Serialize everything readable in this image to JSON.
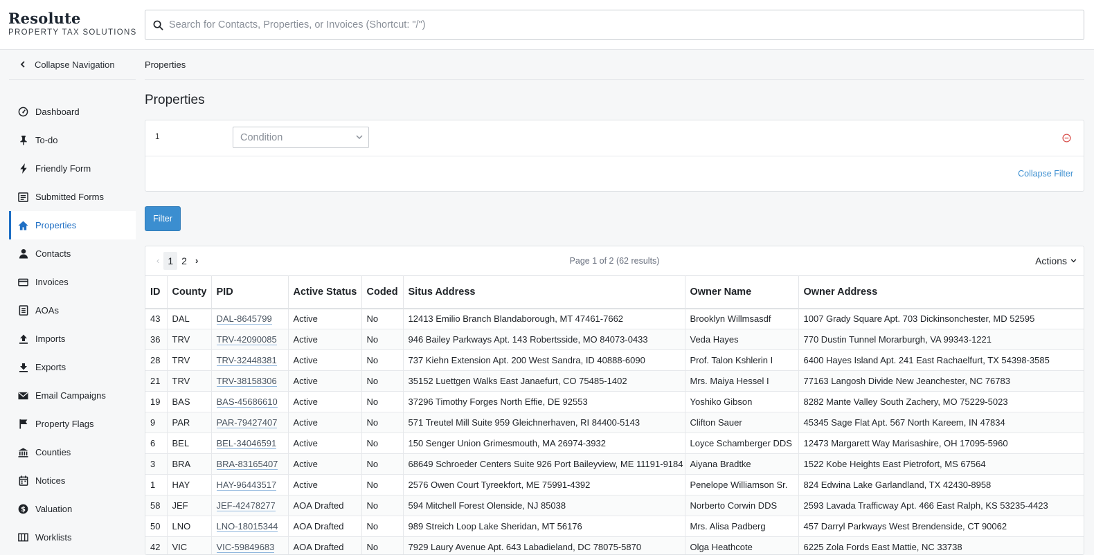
{
  "brand": {
    "name": "Resolute",
    "subtitle": "PROPERTY TAX SOLUTIONS"
  },
  "search": {
    "placeholder": "Search for Contacts, Properties, or Invoices (Shortcut: \"/\")"
  },
  "sidebar": {
    "collapse_label": "Collapse Navigation",
    "items": [
      {
        "label": "Dashboard",
        "icon": "dashboard-icon"
      },
      {
        "label": "To-do",
        "icon": "pin-icon"
      },
      {
        "label": "Friendly Form",
        "icon": "lightning-icon"
      },
      {
        "label": "Submitted Forms",
        "icon": "form-icon"
      },
      {
        "label": "Properties",
        "icon": "home-icon",
        "active": true
      },
      {
        "label": "Contacts",
        "icon": "person-icon"
      },
      {
        "label": "Invoices",
        "icon": "card-icon"
      },
      {
        "label": "AOAs",
        "icon": "document-icon"
      },
      {
        "label": "Imports",
        "icon": "upload-icon"
      },
      {
        "label": "Exports",
        "icon": "download-icon"
      },
      {
        "label": "Email Campaigns",
        "icon": "envelope-icon"
      },
      {
        "label": "Property Flags",
        "icon": "flag-icon"
      },
      {
        "label": "Counties",
        "icon": "bank-icon"
      },
      {
        "label": "Notices",
        "icon": "calendar-icon"
      },
      {
        "label": "Valuation",
        "icon": "dollar-circle-icon"
      },
      {
        "label": "Worklists",
        "icon": "columns-icon"
      }
    ]
  },
  "breadcrumb": "Properties",
  "page_title": "Properties",
  "filter": {
    "index": "1",
    "condition_placeholder": "Condition",
    "collapse_label": "Collapse Filter",
    "button_label": "Filter"
  },
  "pager": {
    "prev": "‹",
    "pages": [
      "1",
      "2"
    ],
    "current": "1",
    "next": "›",
    "info": "Page 1 of 2 (62 results)"
  },
  "actions_label": "Actions",
  "colors": {
    "accent": "#3b8ed0",
    "active_nav": "#1f6fc4",
    "danger": "#d9534f"
  },
  "table": {
    "columns": [
      "ID",
      "County",
      "PID",
      "Active Status",
      "Coded",
      "Situs Address",
      "Owner Name",
      "Owner Address"
    ],
    "rows": [
      [
        "43",
        "DAL",
        "DAL-8645799",
        "Active",
        "No",
        "12413 Emilio Branch Blandaborough, MT 47461-7662",
        "Brooklyn Willmsasdf",
        "1007 Grady Square Apt. 703 Dickinsonchester, MD 52595"
      ],
      [
        "36",
        "TRV",
        "TRV-42090085",
        "Active",
        "No",
        "946 Bailey Parkways Apt. 143 Robertsside, MO 84073-0433",
        "Veda Hayes",
        "770 Dustin Tunnel Morarburgh, VA 99343-1221"
      ],
      [
        "28",
        "TRV",
        "TRV-32448381",
        "Active",
        "No",
        "737 Kiehn Extension Apt. 200 West Sandra, ID 40888-6090",
        "Prof. Talon Kshlerin I",
        "6400 Hayes Island Apt. 241 East Rachaelfurt, TX 54398-3585"
      ],
      [
        "21",
        "TRV",
        "TRV-38158306",
        "Active",
        "No",
        "35152 Luettgen Walks East Janaefurt, CO 75485-1402",
        "Mrs. Maiya Hessel I",
        "77163 Langosh Divide New Jeanchester, NC 76783"
      ],
      [
        "19",
        "BAS",
        "BAS-45686610",
        "Active",
        "No",
        "37296 Timothy Forges North Effie, DE 92553",
        "Yoshiko Gibson",
        "8282 Mante Valley South Zachery, MO 75229-5023"
      ],
      [
        "9",
        "PAR",
        "PAR-79427407",
        "Active",
        "No",
        "571 Treutel Mill Suite 959 Gleichnerhaven, RI 84400-5143",
        "Clifton Sauer",
        "45345 Sage Flat Apt. 567 North Kareem, IN 47834"
      ],
      [
        "6",
        "BEL",
        "BEL-34046591",
        "Active",
        "No",
        "150 Senger Union Grimesmouth, MA 26974-3932",
        "Loyce Schamberger DDS",
        "12473 Margarett Way Marisashire, OH 17095-5960"
      ],
      [
        "3",
        "BRA",
        "BRA-83165407",
        "Active",
        "No",
        "68649 Schroeder Centers Suite 926 Port Baileyview, ME 11191-9184",
        "Aiyana Bradtke",
        "1522 Kobe Heights East Pietrofort, MS 67564"
      ],
      [
        "1",
        "HAY",
        "HAY-96443517",
        "Active",
        "No",
        "2576 Owen Court Tyreekfort, ME 75991-4392",
        "Penelope Williamson Sr.",
        "824 Edwina Lake Garlandland, TX 42430-8958"
      ],
      [
        "58",
        "JEF",
        "JEF-42478277",
        "AOA Drafted",
        "No",
        "594 Mitchell Forest Olenside, NJ 85038",
        "Norberto Corwin DDS",
        "2593 Lavada Trafficway Apt. 466 East Ralph, KS 53235-4423"
      ],
      [
        "50",
        "LNO",
        "LNO-18015344",
        "AOA Drafted",
        "No",
        "989 Streich Loop Lake Sheridan, MT 56176",
        "Mrs. Alisa Padberg",
        "457 Darryl Parkways West Brendenside, CT 90062"
      ],
      [
        "42",
        "VIC",
        "VIC-59849683",
        "AOA Drafted",
        "No",
        "7929 Laury Avenue Apt. 643 Labadieland, DC 78075-5870",
        "Olga Heathcote",
        "6225 Zola Fords East Mattie, NC 33738"
      ]
    ]
  }
}
